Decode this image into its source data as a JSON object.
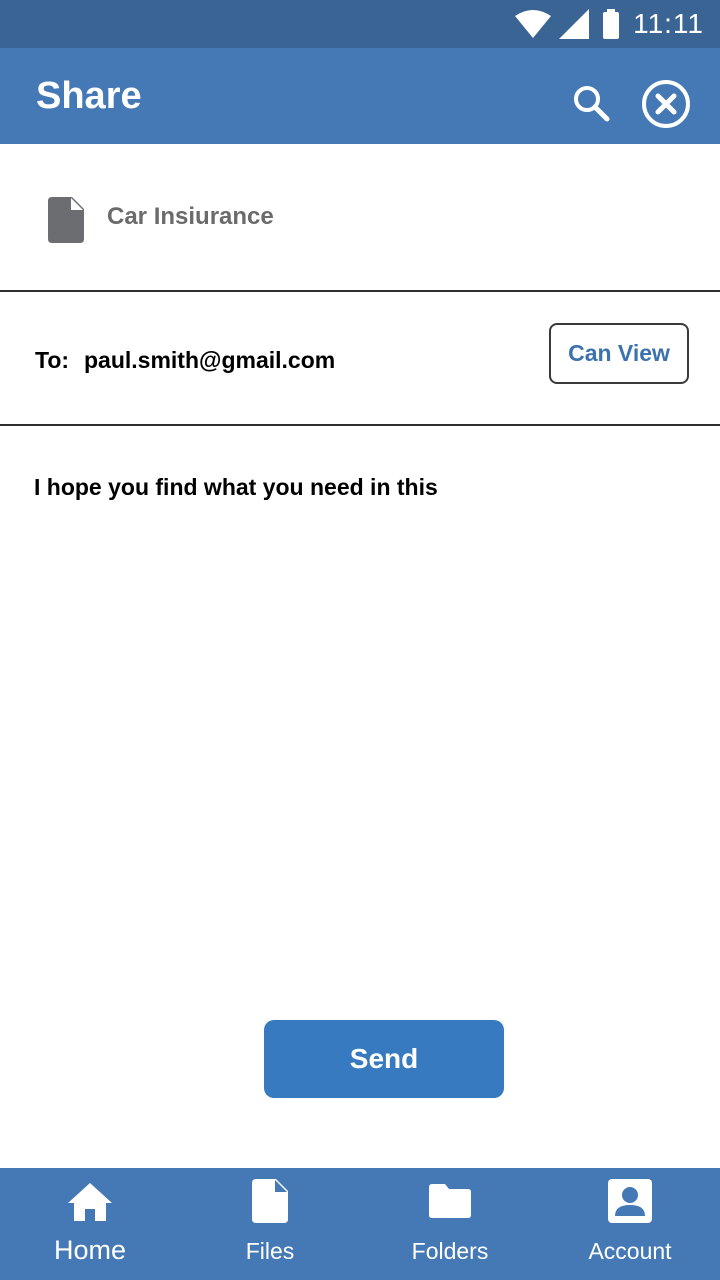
{
  "status_bar": {
    "time": "11:11",
    "icons": [
      "wifi-icon",
      "signal-icon",
      "battery-icon"
    ]
  },
  "app_bar": {
    "title": "Share",
    "icons": [
      "search-icon",
      "close-circle-icon"
    ]
  },
  "file": {
    "name": "Car Insiurance",
    "icon": "file-icon"
  },
  "recipient": {
    "label": "To:",
    "email": "paul.smith@gmail.com",
    "permission": "Can View"
  },
  "message": {
    "text": "I hope you find what you need in this"
  },
  "send_label": "Send",
  "bottom_nav": {
    "items": [
      {
        "label": "Home",
        "icon": "home-icon",
        "active": true
      },
      {
        "label": "Files",
        "icon": "file-icon"
      },
      {
        "label": "Folders",
        "icon": "folder-icon"
      },
      {
        "label": "Account",
        "icon": "account-icon"
      }
    ]
  },
  "colors": {
    "status_bar": "#3a6494",
    "app_bar": "#4579b5",
    "accent": "#377ac0",
    "text_muted": "#6b6b6b"
  }
}
